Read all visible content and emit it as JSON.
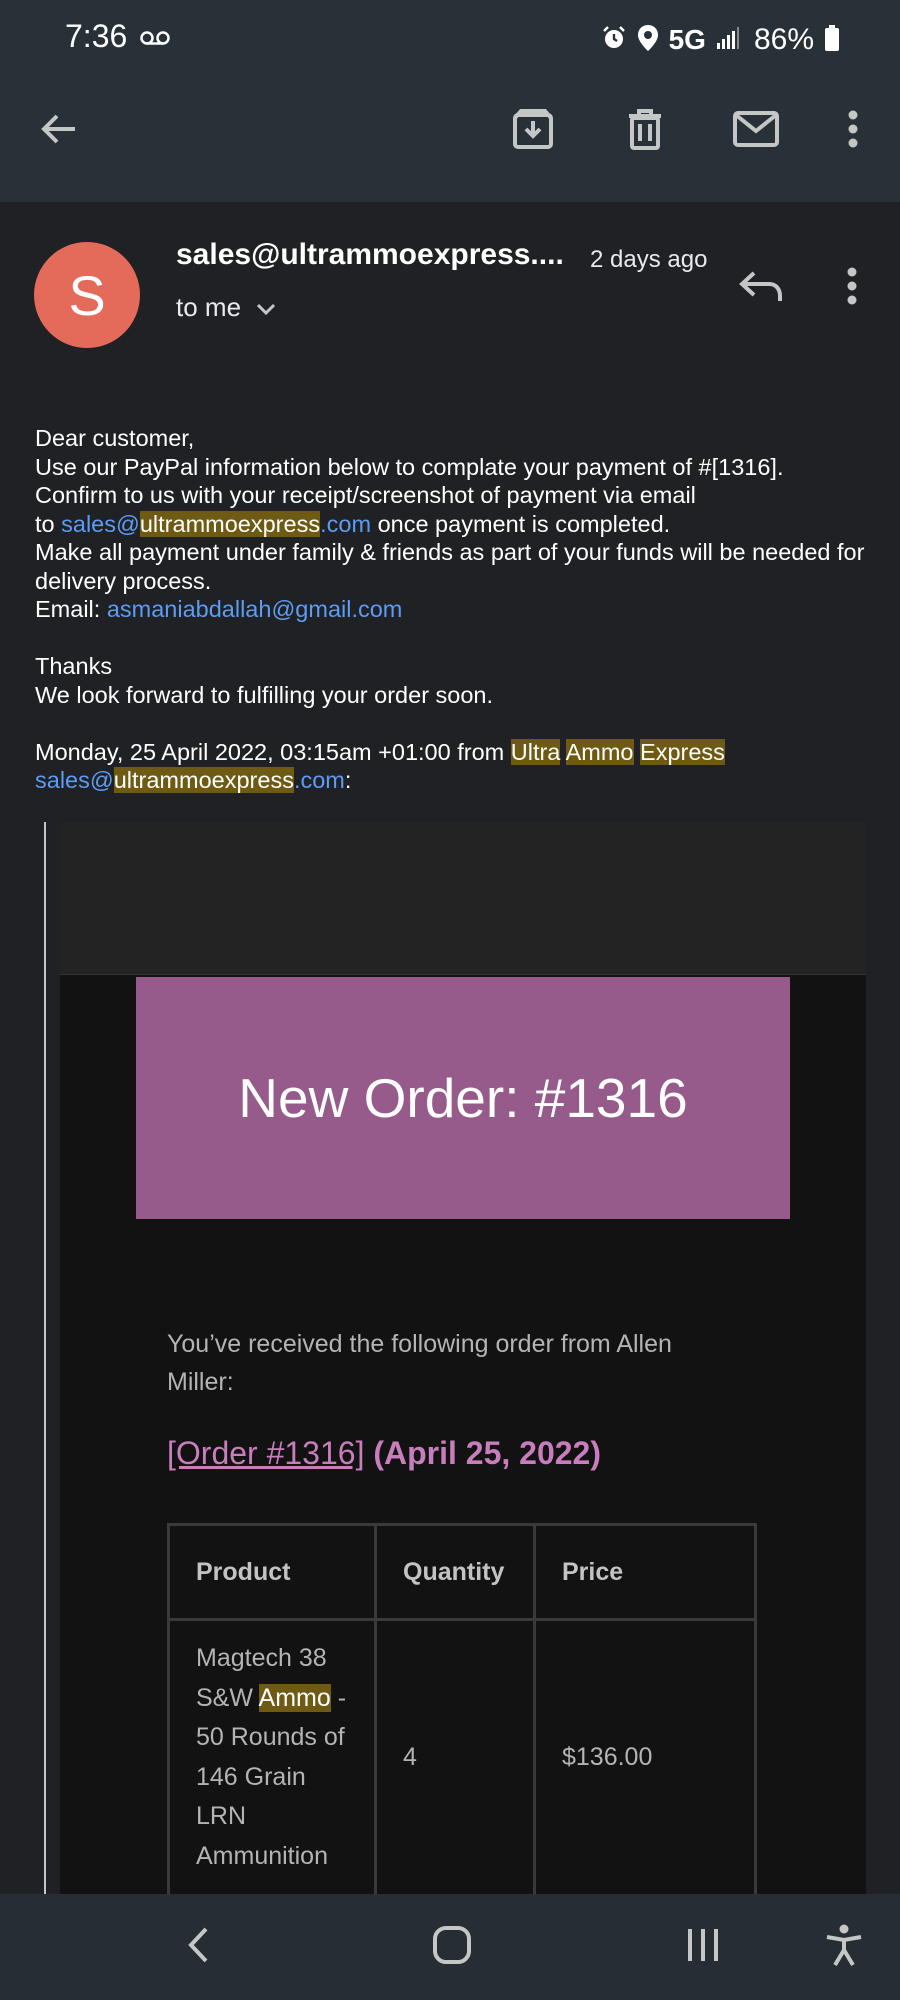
{
  "status_bar": {
    "time": "7:36",
    "network": "5G",
    "battery": "86%",
    "icons": [
      "voicemail-icon",
      "alarm-icon",
      "location-icon",
      "signal-icon",
      "battery-icon"
    ]
  },
  "app_bar": {
    "icons": [
      "back-arrow-icon",
      "archive-icon",
      "trash-icon",
      "mail-icon",
      "more-vert-icon"
    ]
  },
  "header": {
    "avatar_letter": "S",
    "avatar_color": "#e46a5a",
    "sender": "sales@ultrammoexpress....",
    "date": "2 days ago",
    "to_me": "to me"
  },
  "body": {
    "greeting": "Dear customer,",
    "line1": "Use our PayPal information below to complate your payment of #[1316].",
    "line2": "Confirm to us with your receipt/screenshot of payment via email",
    "to_prefix": "to",
    "email_link_pre": "sales@",
    "email_link_hl": "ultrammoexpress",
    "email_link_post": ".com",
    "to_suffix": "once payment is completed.",
    "line4": "Make all payment under family & friends as part of your funds will be needed for delivery process.",
    "email_label": "Email:",
    "paypal_email": "asmaniabdallah@gmail.com",
    "thanks": "Thanks",
    "forward": "We look forward to fulfilling your order soon.",
    "quote_header_pre": "Monday, 25 April 2022, 03:15am +01:00 from",
    "quote_from_1": "Ultra",
    "quote_from_2": "Ammo",
    "quote_from_3": "Express",
    "quote_email_pre": "sales@",
    "quote_email_hl": "ultrammoexpress",
    "quote_email_post": ".com",
    "quote_colon": ":"
  },
  "quoted": {
    "banner_color": "#965a8b",
    "order_title": "New Order: #1316",
    "received_text": "You’ve received the following order from Allen Miller:",
    "order_link": "[Order #1316]",
    "order_date": "(April 25, 2022)",
    "table": {
      "headers": [
        "Product",
        "Quantity",
        "Price"
      ],
      "row": {
        "product_pre": "Magtech 38 S&W",
        "product_hl": "Ammo",
        "product_post": "- 50 Rounds of 146 Grain LRN Ammunition",
        "quantity": "4",
        "price": "$136.00"
      }
    }
  },
  "nav_bar": {
    "icons": [
      "nav-back-icon",
      "home-icon",
      "recents-icon",
      "accessibility-icon"
    ]
  }
}
